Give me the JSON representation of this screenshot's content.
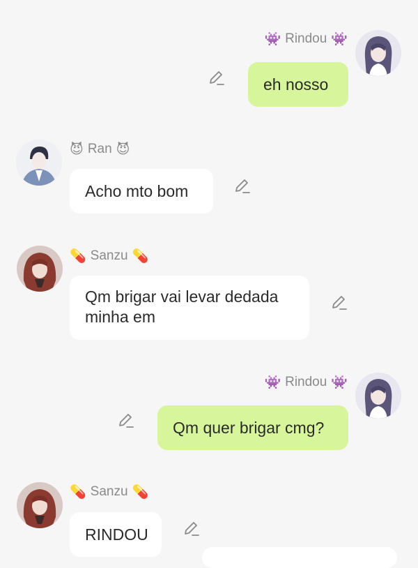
{
  "messages": [
    {
      "sender": "Rindou",
      "side": "right",
      "emoji": "👾",
      "text": "eh nosso"
    },
    {
      "sender": "Ran",
      "side": "left",
      "emoji": "😈",
      "text": "Acho mto bom"
    },
    {
      "sender": "Sanzu",
      "side": "left",
      "emoji": "💊",
      "text": "Qm brigar vai levar dedada\nminha em"
    },
    {
      "sender": "Rindou",
      "side": "right",
      "emoji": "👾",
      "text": "Qm quer brigar cmg?"
    },
    {
      "sender": "Sanzu",
      "side": "left",
      "emoji": "💊",
      "text": "RINDOU"
    }
  ],
  "colors": {
    "outgoing_bubble": "#d7f59a",
    "incoming_bubble": "#ffffff",
    "background": "#f6f6f6",
    "name_text": "#8a8a8a"
  },
  "icons": {
    "edit": "pencil-edit-icon",
    "avatar": "user-avatar"
  }
}
